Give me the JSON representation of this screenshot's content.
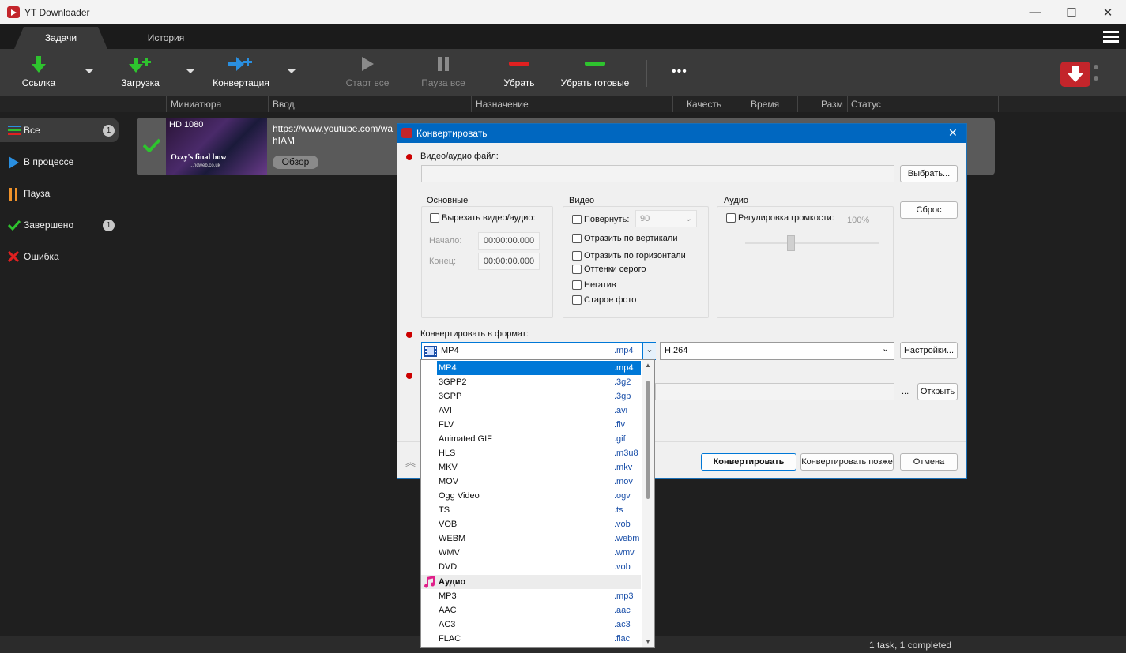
{
  "window": {
    "title": "YT Downloader",
    "minimize": "—",
    "maximize": "☐",
    "close": "✕"
  },
  "tabs": [
    {
      "label": "Задачи"
    },
    {
      "label": "История"
    }
  ],
  "toolbar": {
    "link": "Ссылка",
    "download": "Загрузка",
    "convert": "Конвертация",
    "start_all": "Старт все",
    "pause_all": "Пауза все",
    "remove": "Убрать",
    "remove_done": "Убрать готовые",
    "more": "•••"
  },
  "columns": [
    "Миниатюра",
    "Ввод",
    "Назначение",
    "Качесть",
    "Время",
    "Разм",
    "Статус"
  ],
  "sidebar": {
    "items": [
      {
        "label": "Все",
        "count": "1"
      },
      {
        "label": "В процессе"
      },
      {
        "label": "Пауза"
      },
      {
        "label": "Завершено",
        "count": "1"
      },
      {
        "label": "Ошибка"
      }
    ]
  },
  "task": {
    "url": "https://www.youtube.com/wa",
    "url2": "hIAM",
    "browse": "Обзор",
    "thumb_badge": "HD 1080",
    "thumb_caption": "Ozzy's final bow",
    "thumb_small": "...ndweb.co.uk"
  },
  "status": {
    "text": "1 task, 1 completed"
  },
  "dialog": {
    "title": "Конвертировать",
    "close": "✕",
    "file_label": "Видео/аудио файл:",
    "choose": "Выбрать...",
    "reset": "Сброс",
    "basic": {
      "title": "Основные",
      "cut": "Вырезать видео/аудио:",
      "start_label": "Начало:",
      "start": "00:00:00.000",
      "end_label": "Конец:",
      "end": "00:00:00.000"
    },
    "video": {
      "title": "Видео",
      "rotate": "Повернуть:",
      "rotate_val": "90",
      "flip_v": "Отразить по вертикали",
      "flip_h": "Отразить по горизонтали",
      "gray": "Оттенки серого",
      "negative": "Негатив",
      "old": "Старое фото"
    },
    "audio": {
      "title": "Аудио",
      "volume": "Регулировка громкости:",
      "volume_val": "100%"
    },
    "format_label": "Конвертировать в формат:",
    "format": {
      "name": "MP4",
      "ext": ".mp4"
    },
    "codec": "H.264",
    "settings": "Настройки...",
    "dots": "...",
    "open": "Открыть",
    "convert": "Конвертировать",
    "convert_later": "Конвертировать позже",
    "cancel": "Отмена"
  },
  "formats": [
    {
      "name": "MP4",
      "ext": ".mp4"
    },
    {
      "name": "3GPP2",
      "ext": ".3g2"
    },
    {
      "name": "3GPP",
      "ext": ".3gp"
    },
    {
      "name": "AVI",
      "ext": ".avi"
    },
    {
      "name": "FLV",
      "ext": ".flv"
    },
    {
      "name": "Animated GIF",
      "ext": ".gif"
    },
    {
      "name": "HLS",
      "ext": ".m3u8"
    },
    {
      "name": "MKV",
      "ext": ".mkv"
    },
    {
      "name": "MOV",
      "ext": ".mov"
    },
    {
      "name": "Ogg Video",
      "ext": ".ogv"
    },
    {
      "name": "TS",
      "ext": ".ts"
    },
    {
      "name": "VOB",
      "ext": ".vob"
    },
    {
      "name": "WEBM",
      "ext": ".webm"
    },
    {
      "name": "WMV",
      "ext": ".wmv"
    },
    {
      "name": "DVD",
      "ext": ".vob"
    }
  ],
  "audio_header": "Аудио",
  "audio_formats": [
    {
      "name": "MP3",
      "ext": ".mp3"
    },
    {
      "name": "AAC",
      "ext": ".aac"
    },
    {
      "name": "AC3",
      "ext": ".ac3"
    },
    {
      "name": "FLAC",
      "ext": ".flac"
    }
  ]
}
